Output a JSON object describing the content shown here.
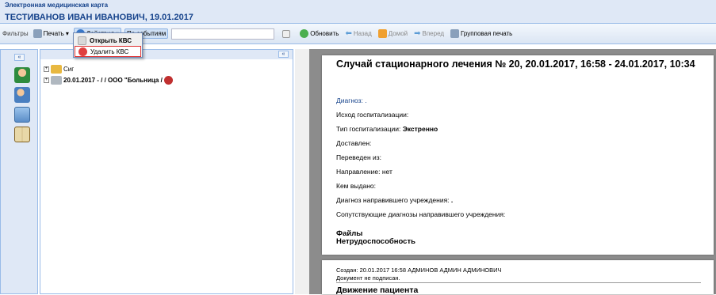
{
  "app": {
    "title": "Электронная медицинская карта",
    "patient": "ТЕСТИВАНОВ ИВАН ИВАНОВИЧ, 19.01.2017"
  },
  "toolbar": {
    "filters_label": "Фильтры",
    "print_label": "Печать",
    "actions_label": "Действия",
    "by_events_label": "По событиям",
    "refresh_label": "Обновить",
    "back_label": "Назад",
    "home_label": "Домой",
    "forward_label": "Вперед",
    "group_print_label": "Групповая печать",
    "search_value": ""
  },
  "actions_menu": {
    "items": [
      {
        "label": "Открыть КВС"
      },
      {
        "label": "Удалить КВС"
      }
    ]
  },
  "tree": {
    "rows": [
      {
        "label": "Сиг"
      },
      {
        "label": "20.01.2017 - / / ООО \"Больница /"
      }
    ]
  },
  "document": {
    "title": "Случай стационарного лечения № 20, 20.01.2017, 16:58 - 24.01.2017, 10:34",
    "fields": [
      {
        "label": "Диагноз: ."
      },
      {
        "label": "Исход госпитализации:"
      },
      {
        "label": "Тип госпитализации: ",
        "value": "Экстренно"
      },
      {
        "label": "Доставлен:"
      },
      {
        "label": "Переведен из:"
      },
      {
        "label": "Направление: нет"
      },
      {
        "label": "Кем выдано:"
      },
      {
        "label": "Диагноз направившего учреждения: ",
        "value": "."
      },
      {
        "label": "Сопутствующие диагнозы направившего учреждения:"
      }
    ],
    "incapacity_heading": "Нетрудоспособность",
    "files_heading": "Файлы"
  },
  "document2": {
    "created": "Создан: 20.01.2017 16:58 АДМИНОВ АДМИН АДМИНОВИЧ",
    "not_signed": "Документ не подписан.",
    "movement_heading": "Движение пациента"
  },
  "sidebar": {
    "collapse_glyph": "«",
    "icons": [
      "person-icon",
      "users-icon",
      "monitor-user-icon",
      "book-icon"
    ]
  },
  "colors": {
    "header_bg": "#dfe8f6",
    "header_text": "#15428b",
    "border": "#99bbe8",
    "menu_highlight_border": "#e03030"
  }
}
